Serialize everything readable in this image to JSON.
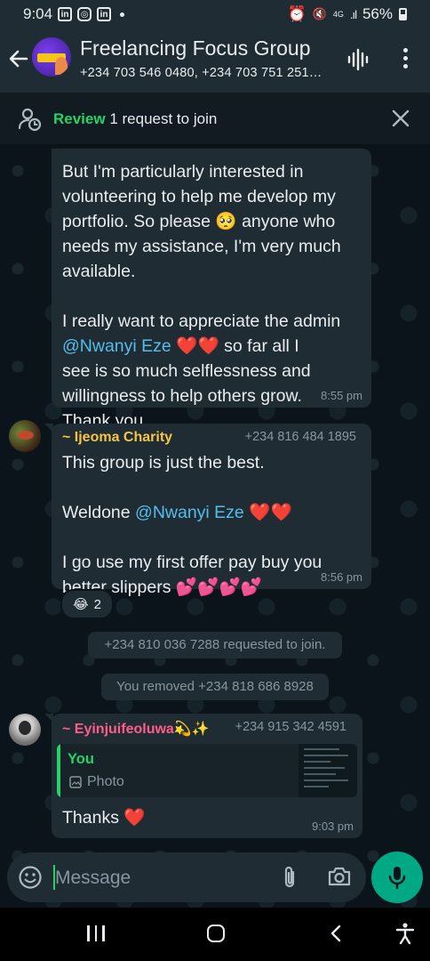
{
  "status_bar": {
    "time": "9:04",
    "battery": "56%",
    "network": "4G"
  },
  "header": {
    "title": "Freelancing Focus Group",
    "participants": "+234 703 546 0480, +234 703 751 251…",
    "back_icon": "arrow-left-icon",
    "more_icon": "more-vertical-icon",
    "call_icon": "audio-wave-icon"
  },
  "review": {
    "label": "Review",
    "text": "1 request to join"
  },
  "messages": [
    {
      "id": "m1",
      "text_1": "But I'm particularly interested in\nvolunteering to help me develop my\nportfolio. So please",
      "emoji_1": "🥺",
      "text_2": " anyone who\nneeds my assistance, I'm very much\navailable.\n\nI really want to appreciate the admin\n",
      "mention": "@Nwanyi Eze",
      "emoji_2": "❤️❤️",
      "text_3": "  so far all I\nsee is so much selflessness and\nwillingness to help others grow.\nThank you",
      "time": "8:55 pm"
    },
    {
      "id": "m2",
      "sender": "~ Ijeoma Charity",
      "sender_color": "#f5c542",
      "phone": "+234 816 484 1895",
      "line_1": "This group is just the best.\n\nWeldone ",
      "mention": "@Nwanyi Eze",
      "emoji_1": " ❤️❤️",
      "line_2": "\n\nI go use my first offer pay buy you\nbetter slippers ",
      "emoji_2": "💕💕💕💕",
      "time": "8:56 pm",
      "reaction_emoji": "😂",
      "reaction_count": "2"
    },
    {
      "id": "m3",
      "sender": "~ Eyinjuifeoluwa💫✨",
      "phone": "+234 915 342 4591",
      "quote_author": "You",
      "quote_type": "Photo",
      "text": "Thanks ❤️",
      "time": "9:03 pm"
    }
  ],
  "system_messages": [
    "+234 810 036 7288 requested to join.",
    "You removed +234 818 686 8928"
  ],
  "composer": {
    "placeholder": "Message"
  }
}
